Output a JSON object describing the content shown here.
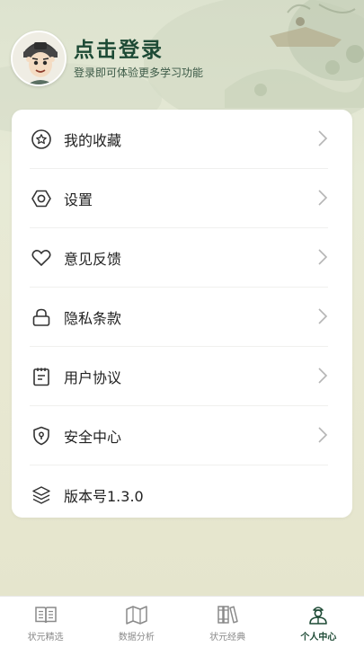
{
  "header": {
    "title": "点击登录",
    "subtitle": "登录即可体验更多学习功能"
  },
  "menu": {
    "items": [
      {
        "label": "我的收藏",
        "icon": "star-circle-icon",
        "chevron": true
      },
      {
        "label": "设置",
        "icon": "hexagon-gear-icon",
        "chevron": true
      },
      {
        "label": "意见反馈",
        "icon": "heart-icon",
        "chevron": true
      },
      {
        "label": "隐私条款",
        "icon": "lock-icon",
        "chevron": true
      },
      {
        "label": "用户协议",
        "icon": "notepad-icon",
        "chevron": true
      },
      {
        "label": "安全中心",
        "icon": "shield-keyhole-icon",
        "chevron": true
      },
      {
        "label": "版本号1.3.0",
        "icon": "layers-icon",
        "chevron": false
      }
    ]
  },
  "tabbar": {
    "tabs": [
      {
        "label": "状元精选",
        "icon": "open-book-icon",
        "active": false
      },
      {
        "label": "数据分析",
        "icon": "map-icon",
        "active": false
      },
      {
        "label": "状元经典",
        "icon": "books-icon",
        "active": false
      },
      {
        "label": "个人中心",
        "icon": "person-icon",
        "active": true
      }
    ]
  },
  "colors": {
    "accent": "#1d4a35",
    "inactive": "#8a8a8a",
    "background": "#e6e6d1"
  }
}
